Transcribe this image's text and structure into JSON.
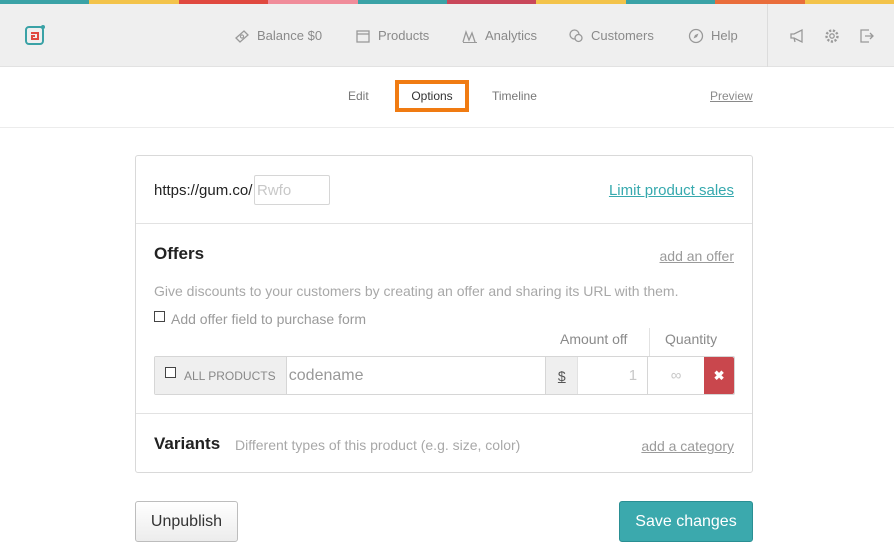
{
  "stripe_colors": [
    "#3aa2a6",
    "#f3c34a",
    "#e0493f",
    "#f08c9a",
    "#3aa2a6",
    "#c9475a",
    "#f3c34a",
    "#3aa2a6",
    "#e96d3b",
    "#f3c34a"
  ],
  "topnav": {
    "items": [
      {
        "label": "Balance $0",
        "icon": "money-icon"
      },
      {
        "label": "Products",
        "icon": "calendar-icon"
      },
      {
        "label": "Analytics",
        "icon": "chart-icon"
      },
      {
        "label": "Customers",
        "icon": "chat-icon"
      },
      {
        "label": "Help",
        "icon": "compass-icon"
      }
    ],
    "tools": [
      "megaphone-icon",
      "gear-icon",
      "logout-icon"
    ]
  },
  "subnav": {
    "tabs": [
      {
        "label": "Edit"
      },
      {
        "label": "Options",
        "active": true
      },
      {
        "label": "Timeline"
      }
    ],
    "preview_label": "Preview"
  },
  "url": {
    "prefix": "https://gum.co/",
    "placeholder": "Rwfo",
    "limit_link": "Limit product sales"
  },
  "offers": {
    "title": "Offers",
    "add_link": "add an offer",
    "description": "Give discounts to your customers by creating an offer and sharing its URL with them.",
    "checkbox_label": "Add offer field to purchase form",
    "col_amount": "Amount off",
    "col_quantity": "Quantity",
    "row": {
      "scope_label": "ALL PRODUCTS",
      "code_placeholder": "codename",
      "currency": "$",
      "amount_placeholder": "1",
      "quantity_placeholder": "∞",
      "delete_glyph": "✖"
    }
  },
  "variants": {
    "title": "Variants",
    "description": "Different types of this product (e.g. size, color)",
    "add_link": "add a category"
  },
  "buttons": {
    "unpublish": "Unpublish",
    "save": "Save changes"
  },
  "accent_color": "#3ba9ad",
  "highlight_color": "#f07b12"
}
